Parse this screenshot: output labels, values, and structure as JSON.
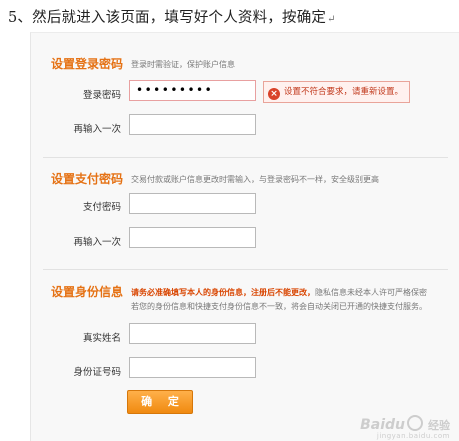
{
  "caption": {
    "text": "5、然后就进入该页面，填写好个人资料，按确定",
    "return_mark": "↵"
  },
  "sections": {
    "login": {
      "title": "设置登录密码",
      "desc": "登录时需验证，保护账户信息",
      "fields": [
        {
          "label": "登录密码",
          "value": "•••••••••"
        },
        {
          "label": "再输入一次",
          "value": ""
        }
      ],
      "error": "设置不符合要求，请重新设置。",
      "error_icon": "error-x-icon"
    },
    "payment": {
      "title": "设置支付密码",
      "desc": "交易付款或账户信息更改时需输入，与登录密码不一样，安全级别更高",
      "fields": [
        {
          "label": "支付密码",
          "value": ""
        },
        {
          "label": "再输入一次",
          "value": ""
        }
      ]
    },
    "identity": {
      "title": "设置身份信息",
      "desc_red": "请务必准确填写本人的身份信息，注册后不能更改，",
      "desc_rest": "隐私信息未经本人许可严格保密",
      "desc_line2": "若您的身份信息和快捷支付身份信息不一致，将会自动关闭已开通的快捷支付服务。",
      "fields": [
        {
          "label": "真实姓名",
          "value": ""
        },
        {
          "label": "身份证号码",
          "value": ""
        }
      ]
    }
  },
  "confirm_button": "确 定",
  "watermark": {
    "brand": "Baidu",
    "sub": "经验",
    "url": "jingyan.baidu.com"
  },
  "colors": {
    "accent": "#e57215",
    "button": "#f08a10",
    "error": "#c1381b"
  }
}
